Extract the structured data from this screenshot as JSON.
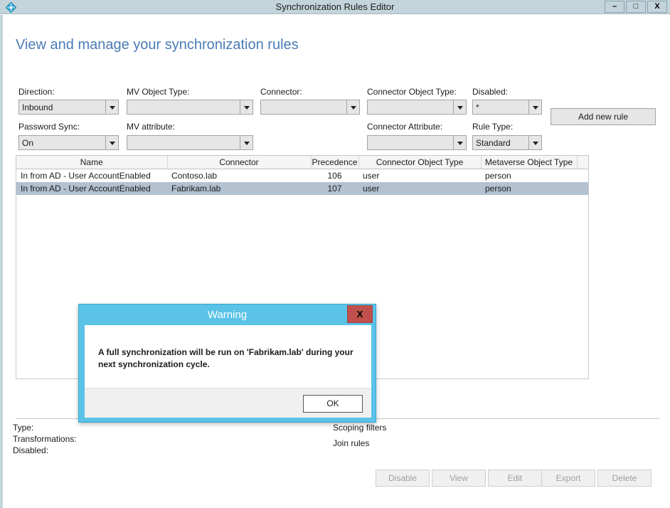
{
  "window": {
    "title": "Synchronization Rules Editor",
    "icon": "sync-diamond-icon",
    "controls": {
      "minimize": "–",
      "maximize": "□",
      "close": "X"
    }
  },
  "page": {
    "heading": "View and manage your synchronization rules",
    "heading_color": "#4b7bb5"
  },
  "filters": [
    {
      "label": "Direction:",
      "value": "Inbound",
      "name": "direction"
    },
    {
      "label": "MV Object Type:",
      "value": "",
      "name": "mv-object-type"
    },
    {
      "label": "Connector:",
      "value": "",
      "name": "connector"
    },
    {
      "label": "Connector Object Type:",
      "value": "",
      "name": "connector-object-type"
    },
    {
      "label": "Disabled:",
      "value": "*",
      "name": "disabled"
    },
    {
      "label": "Password Sync:",
      "value": "On",
      "name": "password-sync"
    },
    {
      "label": "MV attribute:",
      "value": "",
      "name": "mv-attribute"
    },
    {
      "label": "Connector Attribute:",
      "value": "",
      "name": "connector-attribute"
    },
    {
      "label": "Rule Type:",
      "value": "Standard",
      "name": "rule-type"
    }
  ],
  "toolbar": {
    "add_new_rule_label": "Add new rule"
  },
  "rules_table": {
    "columns": [
      "Name",
      "Connector",
      "Precedence",
      "Connector Object Type",
      "Metaverse Object Type"
    ],
    "rows": [
      {
        "name": "In from AD - User AccountEnabled",
        "connector": "Contoso.lab",
        "precedence": "106",
        "connector_object_type": "user",
        "metaverse_object_type": "person",
        "selected": false
      },
      {
        "name": "In from AD - User AccountEnabled",
        "connector": "Fabrikam.lab",
        "precedence": "107",
        "connector_object_type": "user",
        "metaverse_object_type": "person",
        "selected": true
      }
    ]
  },
  "details": {
    "type_label": "Type:",
    "transformations_label": "Transformations:",
    "disabled_label": "Disabled:",
    "scoping_filters_label": "Scoping filters",
    "join_rules_label": "Join rules"
  },
  "bottom_buttons": [
    {
      "label": "Disable",
      "name": "disable-button"
    },
    {
      "label": "View",
      "name": "view-button"
    },
    {
      "label": "Edit",
      "name": "edit-button"
    },
    {
      "label": "Export",
      "name": "export-button"
    },
    {
      "label": "Delete",
      "name": "delete-button"
    }
  ],
  "dialog": {
    "title": "Warning",
    "close_glyph": "X",
    "message": "A full synchronization will be run on 'Fabrikam.lab' during your next synchronization cycle.",
    "ok_label": "OK",
    "accent_color": "#5bc3e8",
    "close_color": "#c0504d"
  }
}
